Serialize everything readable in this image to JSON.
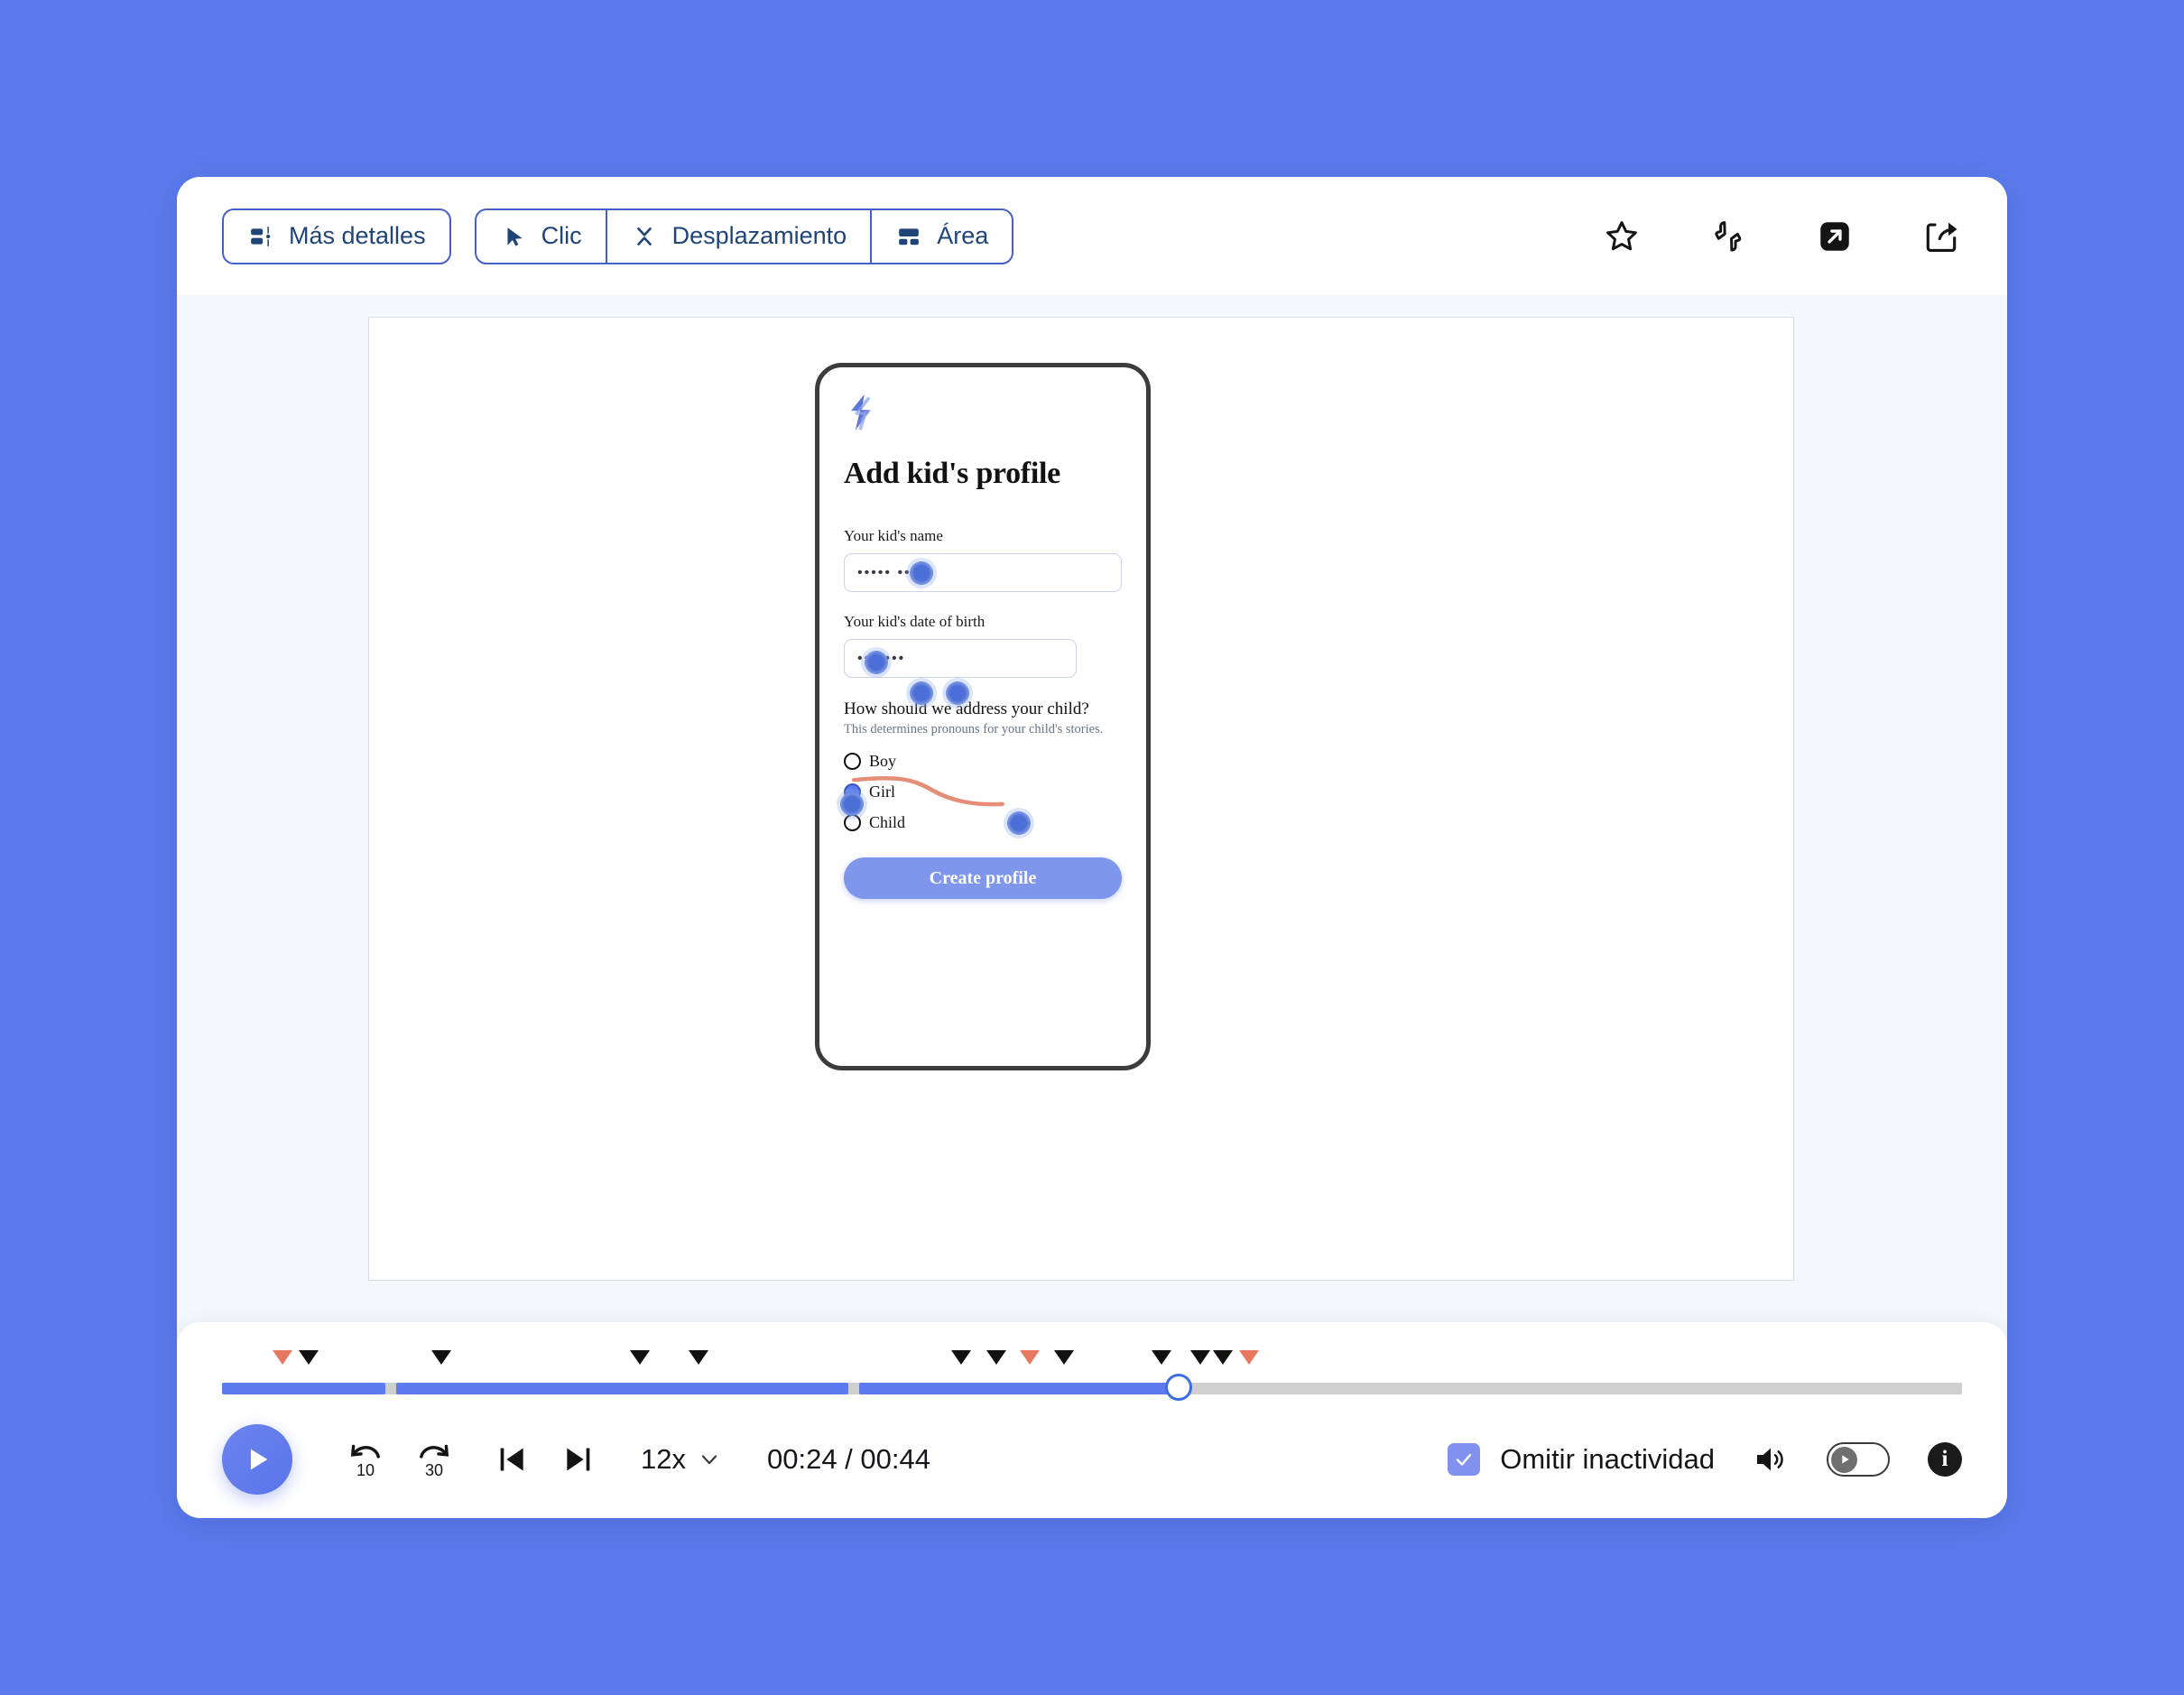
{
  "theme": {
    "page_bg": "#5b7bee",
    "card_bg": "#f4f8fc",
    "toolbar_bg": "#ffffff",
    "accent_blue": "#5b7bee",
    "toolbar_navy": "#1f4477",
    "marker_black": "#111111",
    "marker_red": "#e8775f",
    "checkbox_purple": "#8290f0",
    "played_bar": "#5b7bee",
    "unplayed_bar": "#cfcfcf"
  },
  "toolbar": {
    "details_button": "Más detalles",
    "details_icon": "details-panel-icon",
    "segments": [
      {
        "label": "Clic",
        "icon": "cursor-arrow-icon"
      },
      {
        "label": "Desplazamiento",
        "icon": "scroll-collapse-icon"
      },
      {
        "label": "Área",
        "icon": "area-layout-icon"
      }
    ],
    "actions": [
      {
        "name": "favorite-icon",
        "title": "star"
      },
      {
        "name": "feedback-icon",
        "title": "thumbs-up-down"
      },
      {
        "name": "open-external-icon",
        "title": "open-in-new"
      },
      {
        "name": "share-icon",
        "title": "share"
      }
    ]
  },
  "phone": {
    "logo_icon": "lightning-bolt-logo",
    "title": "Add kid's profile",
    "fields": [
      {
        "label": "Your kid's name",
        "value": "••••• ••••"
      },
      {
        "label": "Your kid's date of birth",
        "value": "•••••••"
      }
    ],
    "question": {
      "title": "How should we address your child?",
      "subtitle": "This determines pronouns for your child's stories.",
      "options": [
        {
          "label": "Boy",
          "selected": false
        },
        {
          "label": "Girl",
          "selected": true
        },
        {
          "label": "Child",
          "selected": false
        }
      ]
    },
    "cta_label": "Create profile"
  },
  "player": {
    "play_icon": "play-icon",
    "rewind_label": "10",
    "forward_label": "30",
    "prev_icon": "skip-previous-icon",
    "next_icon": "skip-next-icon",
    "speed_value": "12x",
    "speed_caret": "chevron-down-icon",
    "time_display": "00:24 / 00:44",
    "skip_inactivity_label": "Omitir inactividad",
    "skip_inactivity_checked": true,
    "volume_icon": "speaker-on-icon",
    "autoplay_toggle": "autoplay-toggle",
    "autoplay_on": false,
    "info_label": "i",
    "progress_percent": 55,
    "segments": [
      {
        "start": 0,
        "end": 9.4,
        "state": "played"
      },
      {
        "start": 10.0,
        "end": 36.0,
        "state": "played"
      },
      {
        "start": 36.6,
        "end": 54.9,
        "state": "played"
      },
      {
        "start": 56.2,
        "end": 100,
        "state": "unplayed"
      }
    ],
    "markers": [
      {
        "pos": 3.5,
        "color": "red"
      },
      {
        "pos": 5.0,
        "color": "black"
      },
      {
        "pos": 12.6,
        "color": "black"
      },
      {
        "pos": 24.0,
        "color": "black"
      },
      {
        "pos": 27.4,
        "color": "black"
      },
      {
        "pos": 42.5,
        "color": "black"
      },
      {
        "pos": 44.5,
        "color": "black"
      },
      {
        "pos": 46.4,
        "color": "red"
      },
      {
        "pos": 48.4,
        "color": "black"
      },
      {
        "pos": 54.0,
        "color": "black"
      },
      {
        "pos": 56.2,
        "color": "black"
      },
      {
        "pos": 57.5,
        "color": "black"
      },
      {
        "pos": 59.0,
        "color": "red"
      }
    ]
  }
}
